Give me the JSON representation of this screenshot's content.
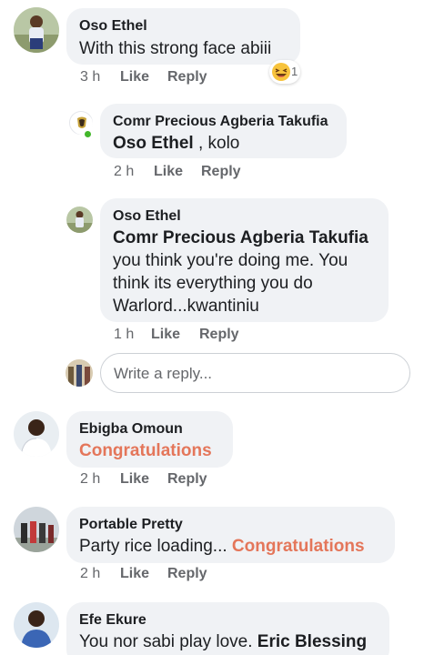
{
  "comments": [
    {
      "author": "Oso Ethel",
      "text": "With this strong face abiii",
      "time": "3 h",
      "reaction_count": "1"
    },
    {
      "author": "Comr Precious Agberia Takufia",
      "mention": "Oso Ethel",
      "text": " , kolo",
      "time": "2 h"
    },
    {
      "author": "Oso Ethel",
      "mention": "Comr Precious Agberia Takufia",
      "text_lines": [
        "you think you're doing me. You",
        "think its everything you do",
        "Warlord...kwantiniu"
      ],
      "time": "1 h"
    },
    {
      "author": "Ebigba Omoun",
      "text": "Congratulations",
      "time": "2 h"
    },
    {
      "author": "Portable Pretty",
      "text": "Party rice loading... ",
      "tag": "Congratulations",
      "time": "2 h"
    },
    {
      "author": "Efe Ekure",
      "text": "You nor sabi play love. ",
      "mention": "Eric Blessing"
    }
  ],
  "actions": {
    "like": "Like",
    "reply": "Reply"
  },
  "reply_box": {
    "placeholder": "Write a reply..."
  },
  "colors": {
    "bubble": "#f0f2f5",
    "link": "#e4765a",
    "online": "#42b72a",
    "meta": "#65676b"
  },
  "icons": {
    "reaction": "laughing-emoji-icon"
  }
}
